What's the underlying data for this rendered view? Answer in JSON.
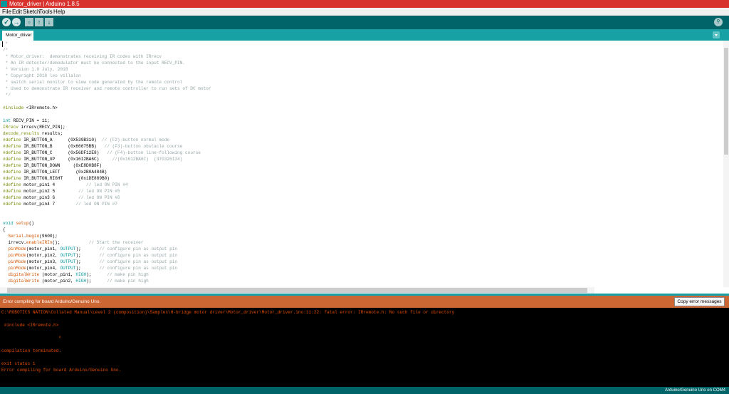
{
  "window": {
    "title": "Motor_driver | Arduino 1.8.5",
    "app_icon": "arduino-logo-icon"
  },
  "menu": [
    "File",
    "Edit",
    "Sketch",
    "Tools",
    "Help"
  ],
  "toolbar": {
    "verify_icon": "check-icon",
    "upload_icon": "arrow-right-icon",
    "new_icon": "new-file-icon",
    "open_icon": "arrow-up-icon",
    "save_icon": "arrow-down-icon",
    "serial_monitor_icon": "magnifier-icon"
  },
  "tabs": [
    {
      "label": "Motor_driver",
      "active": true
    }
  ],
  "editor": {
    "lines": [
      [
        {
          "t": " *",
          "c": "c-comment"
        }
      ],
      [
        {
          "t": "/*",
          "c": "c-comment"
        }
      ],
      [
        {
          "t": " * Motor_driver:  demonstrates receiving IR codes with IRrecv",
          "c": "c-comment"
        }
      ],
      [
        {
          "t": " * An IR detector/demodulator must be connected to the input RECV_PIN.",
          "c": "c-comment"
        }
      ],
      [
        {
          "t": " * Version 1.0 July, 2018",
          "c": "c-comment"
        }
      ],
      [
        {
          "t": " * Copyright 2018 leo villalon",
          "c": "c-comment"
        }
      ],
      [
        {
          "t": " * switch serial monitor to view code generated by the remote control",
          "c": "c-comment"
        }
      ],
      [
        {
          "t": " * Used to demonstrate IR receiver and remote controller to run sets of DC motor",
          "c": "c-comment"
        }
      ],
      [
        {
          "t": " */",
          "c": "c-comment"
        }
      ],
      [],
      [
        {
          "t": "#include",
          "c": "c-keyword"
        },
        {
          "t": " <IRremote.h>"
        }
      ],
      [],
      [
        {
          "t": "int",
          "c": "c-const"
        },
        {
          "t": " RECV_PIN = 11;"
        }
      ],
      [
        {
          "t": "IRrecv",
          "c": "c-keyword"
        },
        {
          "t": " irrecv(RECV_PIN);"
        }
      ],
      [
        {
          "t": "decode_results",
          "c": "c-keyword"
        },
        {
          "t": " results;"
        }
      ],
      [
        {
          "t": "#define",
          "c": "c-keyword"
        },
        {
          "t": " IR_BUTTON_A      (0X539B310)  "
        },
        {
          "t": "// (F2)-button normal mode",
          "c": "c-comment-dark"
        }
      ],
      [
        {
          "t": "#define",
          "c": "c-keyword"
        },
        {
          "t": " IR_BUTTON_B      (0x66675BB)  "
        },
        {
          "t": " // (F3)-button obstacle course",
          "c": "c-comment-dark"
        }
      ],
      [
        {
          "t": "#define",
          "c": "c-keyword"
        },
        {
          "t": " IR_BUTTON_C      (0x56DF12E8)  "
        },
        {
          "t": " // (F4)-button line-following course",
          "c": "c-comment-dark"
        }
      ],
      [
        {
          "t": "#define",
          "c": "c-keyword"
        },
        {
          "t": " IR_BUTTON_UP     (0x1612BA6C)     "
        },
        {
          "t": "//(0x1612BA6C)  (370326124)",
          "c": "c-comment-dark"
        }
      ],
      [
        {
          "t": "#define",
          "c": "c-keyword"
        },
        {
          "t": " IR_BUTTON_DOWN     (0xE8D0B8F)"
        }
      ],
      [
        {
          "t": "#define",
          "c": "c-keyword"
        },
        {
          "t": " IR_BUTTON_LEFT      (0x2B0A484B)"
        }
      ],
      [
        {
          "t": "#define",
          "c": "c-keyword"
        },
        {
          "t": " IR_BUTTON_RIGHT      (0x1DE889B0)"
        }
      ],
      [
        {
          "t": "#define",
          "c": "c-keyword"
        },
        {
          "t": " motor_pin1 4            "
        },
        {
          "t": "// led ON PIN #4",
          "c": "c-comment-dark"
        }
      ],
      [
        {
          "t": "#define",
          "c": "c-keyword"
        },
        {
          "t": " motor_pin2 5         "
        },
        {
          "t": "// led ON PIN #5",
          "c": "c-comment-dark"
        }
      ],
      [
        {
          "t": "#define",
          "c": "c-keyword"
        },
        {
          "t": " motor_pin3 6         "
        },
        {
          "t": "// led ON PIN #6",
          "c": "c-comment-dark"
        }
      ],
      [
        {
          "t": "#define",
          "c": "c-keyword"
        },
        {
          "t": " motor_pin4 7        "
        },
        {
          "t": "// led ON PIN #7",
          "c": "c-comment-dark"
        }
      ],
      [],
      [],
      [
        {
          "t": "void",
          "c": "c-const"
        },
        {
          "t": " "
        },
        {
          "t": "setup",
          "c": "c-func"
        },
        {
          "t": "()"
        }
      ],
      [
        {
          "t": "{"
        }
      ],
      [
        {
          "t": "  "
        },
        {
          "t": "Serial",
          "c": "c-func"
        },
        {
          "t": "."
        },
        {
          "t": "begin",
          "c": "c-func"
        },
        {
          "t": "(9600);"
        }
      ],
      [
        {
          "t": "  irrecv."
        },
        {
          "t": "enableIRIn",
          "c": "c-func"
        },
        {
          "t": "();           "
        },
        {
          "t": "// Start the receiver",
          "c": "c-comment-dark"
        }
      ],
      [
        {
          "t": "  "
        },
        {
          "t": "pinMode",
          "c": "c-func"
        },
        {
          "t": "(motor_pin1, "
        },
        {
          "t": "OUTPUT",
          "c": "c-const"
        },
        {
          "t": ");       "
        },
        {
          "t": "// configure pin as output pin",
          "c": "c-comment-dark"
        }
      ],
      [
        {
          "t": "  "
        },
        {
          "t": "pinMode",
          "c": "c-func"
        },
        {
          "t": "(motor_pin2, "
        },
        {
          "t": "OUTPUT",
          "c": "c-const"
        },
        {
          "t": ");       "
        },
        {
          "t": "// configure pin as output pin",
          "c": "c-comment-dark"
        }
      ],
      [
        {
          "t": "  "
        },
        {
          "t": "pinMode",
          "c": "c-func"
        },
        {
          "t": "(motor_pin3, "
        },
        {
          "t": "OUTPUT",
          "c": "c-const"
        },
        {
          "t": ");       "
        },
        {
          "t": "// configure pin as output pin",
          "c": "c-comment-dark"
        }
      ],
      [
        {
          "t": "  "
        },
        {
          "t": "pinMode",
          "c": "c-func"
        },
        {
          "t": "(motor_pin4, "
        },
        {
          "t": "OUTPUT",
          "c": "c-const"
        },
        {
          "t": ");       "
        },
        {
          "t": "// configure pin as output pin",
          "c": "c-comment-dark"
        }
      ],
      [
        {
          "t": "  "
        },
        {
          "t": "digitalWrite",
          "c": "c-func"
        },
        {
          "t": " (motor_pin1, "
        },
        {
          "t": "HIGH",
          "c": "c-const"
        },
        {
          "t": ");      "
        },
        {
          "t": "// make pin high",
          "c": "c-comment-dark"
        }
      ],
      [
        {
          "t": "  "
        },
        {
          "t": "digitalWrite",
          "c": "c-func"
        },
        {
          "t": " (motor_pin2, "
        },
        {
          "t": "HIGH",
          "c": "c-const"
        },
        {
          "t": ");      "
        },
        {
          "t": "// make pin high",
          "c": "c-comment-dark"
        }
      ]
    ]
  },
  "status": {
    "message": "Error compiling for board Arduino/Genuino Uno.",
    "copy_button": "Copy error messages"
  },
  "console": {
    "lines": [
      "C:\\ROBOTICS NATION\\Collated Manual\\Level 2 (composition)\\Samples\\H-bridge motor driver\\Motor_driver\\Motor_driver.ino:11:22: fatal error: IRremote.h: No such file or directory",
      "",
      " #include <IRremote.h>",
      "",
      "                      ^",
      "",
      "compilation terminated.",
      "",
      "exit status 1",
      "Error compiling for board Arduino/Genuino Uno."
    ]
  },
  "footer": {
    "board": "Arduino/Genuino Uno on COM4"
  },
  "colors": {
    "title_bar": "#d8322f",
    "toolbar": "#006468",
    "tab_bar": "#17a1a5",
    "status_error": "#cc6633",
    "console_bg": "#000000",
    "console_text": "#e34c00"
  }
}
